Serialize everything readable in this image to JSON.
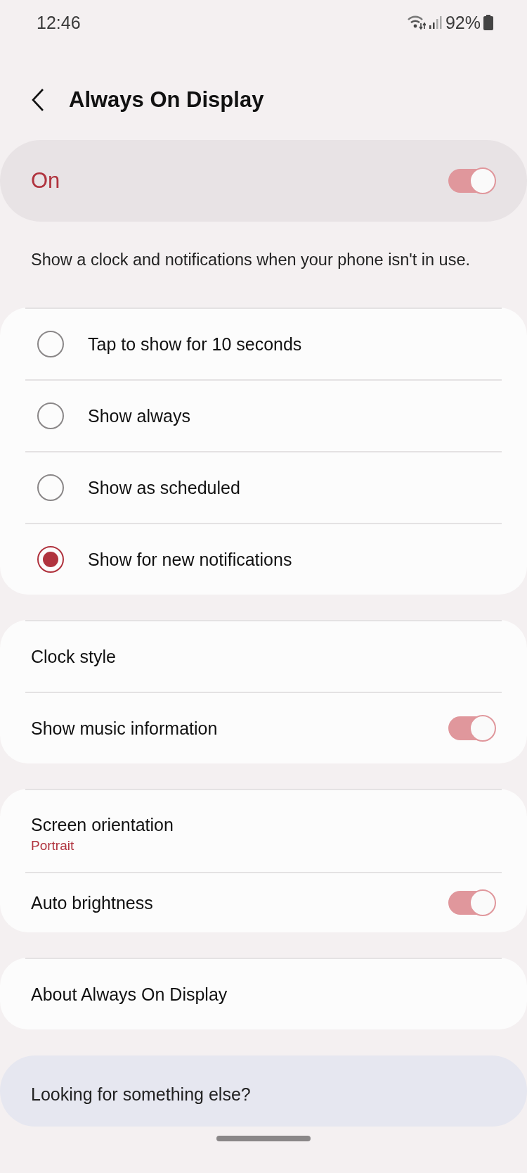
{
  "status_bar": {
    "time": "12:46",
    "battery": "92%"
  },
  "header": {
    "title": "Always On Display"
  },
  "master_switch": {
    "label": "On",
    "on": true
  },
  "description": "Show a clock and notifications when your phone isn't in use.",
  "display_modes": [
    {
      "label": "Tap to show for 10 seconds",
      "selected": false
    },
    {
      "label": "Show always",
      "selected": false
    },
    {
      "label": "Show as scheduled",
      "selected": false
    },
    {
      "label": "Show for new notifications",
      "selected": true
    }
  ],
  "sections": [
    {
      "items": [
        {
          "kind": "link",
          "label": "Clock style"
        },
        {
          "kind": "switch",
          "label": "Show music information",
          "on": true
        }
      ]
    },
    {
      "items": [
        {
          "kind": "link",
          "label": "Screen orientation",
          "value": "Portrait"
        },
        {
          "kind": "switch",
          "label": "Auto brightness",
          "on": true
        }
      ]
    },
    {
      "items": [
        {
          "kind": "link",
          "label": "About Always On Display"
        }
      ]
    }
  ],
  "suggestion": {
    "title": "Looking for something else?"
  }
}
